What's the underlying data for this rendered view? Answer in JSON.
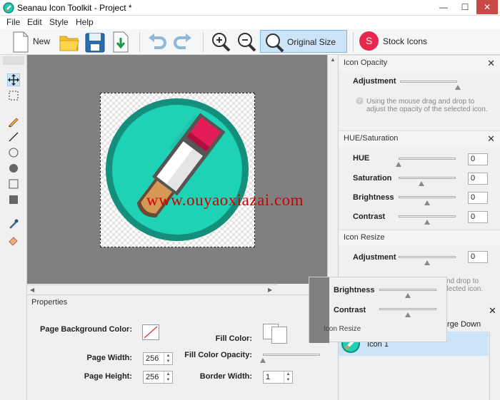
{
  "window": {
    "title": "Seanau Icon Toolkit - Project *",
    "minimize": "—",
    "maximize": "☐",
    "close": "✕"
  },
  "menu": [
    "File",
    "Edit",
    "Style",
    "Help"
  ],
  "toolbar": {
    "new_label": "New",
    "original_size_label": "Original Size",
    "stock_icons_label": "Stock Icons",
    "stock_badge": "S"
  },
  "properties": {
    "header": "Properties",
    "page_bg_label": "Page Background Color:",
    "page_width_label": "Page Width:",
    "page_width": "256",
    "page_height_label": "Page Height:",
    "page_height": "256",
    "fill_color_label": "Fill Color:",
    "fill_opacity_label": "Fill Color Opacity:",
    "border_width_label": "Border Width:",
    "border_width": "1"
  },
  "opacity": {
    "header": "Icon Opacity",
    "adjustment_label": "Adjustment",
    "note": "Using the mouse drag and drop to adjust the opacity of the selected icon."
  },
  "hue": {
    "header": "HUE/Saturation",
    "hue_label": "HUE",
    "hue_value": "0",
    "saturation_label": "Saturation",
    "saturation_value": "0",
    "brightness_label": "Brightness",
    "brightness_value": "0",
    "contrast_label": "Contrast",
    "contrast_value": "0"
  },
  "resize": {
    "header": "Icon Resize",
    "adjustment_label": "Adjustment",
    "adjustment_value": "0",
    "note_frag1": "nd drop to",
    "note_frag2": "elected icon."
  },
  "popup": {
    "brightness_label": "Brightness",
    "contrast_label": "Contrast",
    "footer": "Icon Resize"
  },
  "layers": {
    "merge_down": "rge Down",
    "icon_label": "Icon 1"
  },
  "watermark": "www.ouyaoxiazai.com",
  "colors": {
    "accent": "#1ec8b0",
    "stock_badge": "#e8264e",
    "selection": "#cce4f7"
  }
}
